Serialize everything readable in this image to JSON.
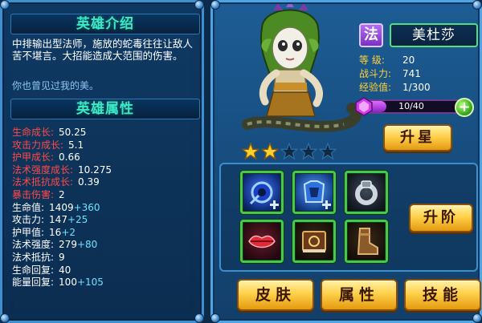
{
  "hero_intro": {
    "title": "英雄介绍",
    "description": "中排输出型法师，施放的蛇毒往往让敌人苦不堪言。大招能造成大范围的伤害。",
    "quote": "你也曾见过我的美。"
  },
  "hero_attributes": {
    "title": "英雄属性",
    "growth": [
      {
        "label": "生命成长:",
        "value": "50.25"
      },
      {
        "label": "攻击力成长:",
        "value": "5.1"
      },
      {
        "label": "护甲成长:",
        "value": "0.66"
      },
      {
        "label": "法术强度成长:",
        "value": "10.275"
      },
      {
        "label": "法术抵抗成长:",
        "value": "0.39"
      }
    ],
    "stats": [
      {
        "label": "暴击伤害:",
        "value": "2",
        "bonus": ""
      },
      {
        "label": "生命值:",
        "value": "1409",
        "bonus": "+360"
      },
      {
        "label": "攻击力:",
        "value": "147",
        "bonus": "+25"
      },
      {
        "label": "护甲值:",
        "value": "16",
        "bonus": "+2"
      },
      {
        "label": "法术强度:",
        "value": "279",
        "bonus": "+80"
      },
      {
        "label": "法术抵抗:",
        "value": "9",
        "bonus": ""
      },
      {
        "label": "生命回复:",
        "value": "40",
        "bonus": ""
      },
      {
        "label": "能量回复:",
        "value": "100",
        "bonus": "+105"
      }
    ]
  },
  "hero": {
    "type_badge": "法",
    "name": "美杜莎",
    "level_label": "等  级:",
    "level": "20",
    "power_label": "战斗力:",
    "power": "741",
    "exp_label": "经验值:",
    "exp": "1/300",
    "shards_text": "10/40",
    "shards_fraction": 0.25,
    "stars_filled": 2,
    "stars_total": 5
  },
  "buttons": {
    "star_up": "升星",
    "advance": "升阶",
    "skin": "皮肤",
    "attributes": "属性",
    "skills": "技能"
  },
  "equipment": [
    {
      "icon": "blue-orb-staff-icon"
    },
    {
      "icon": "blue-armor-icon"
    },
    {
      "icon": "silver-ring-icon"
    },
    {
      "icon": "red-lips-icon"
    },
    {
      "icon": "spell-book-icon"
    },
    {
      "icon": "leather-boots-icon"
    }
  ],
  "colors": {
    "growth_label": "#ff4a4a",
    "bonus": "#6ee0ff",
    "section_title": "#3de8c8",
    "stat_label": "#ffd23a",
    "equip_border": "#46c84a"
  }
}
